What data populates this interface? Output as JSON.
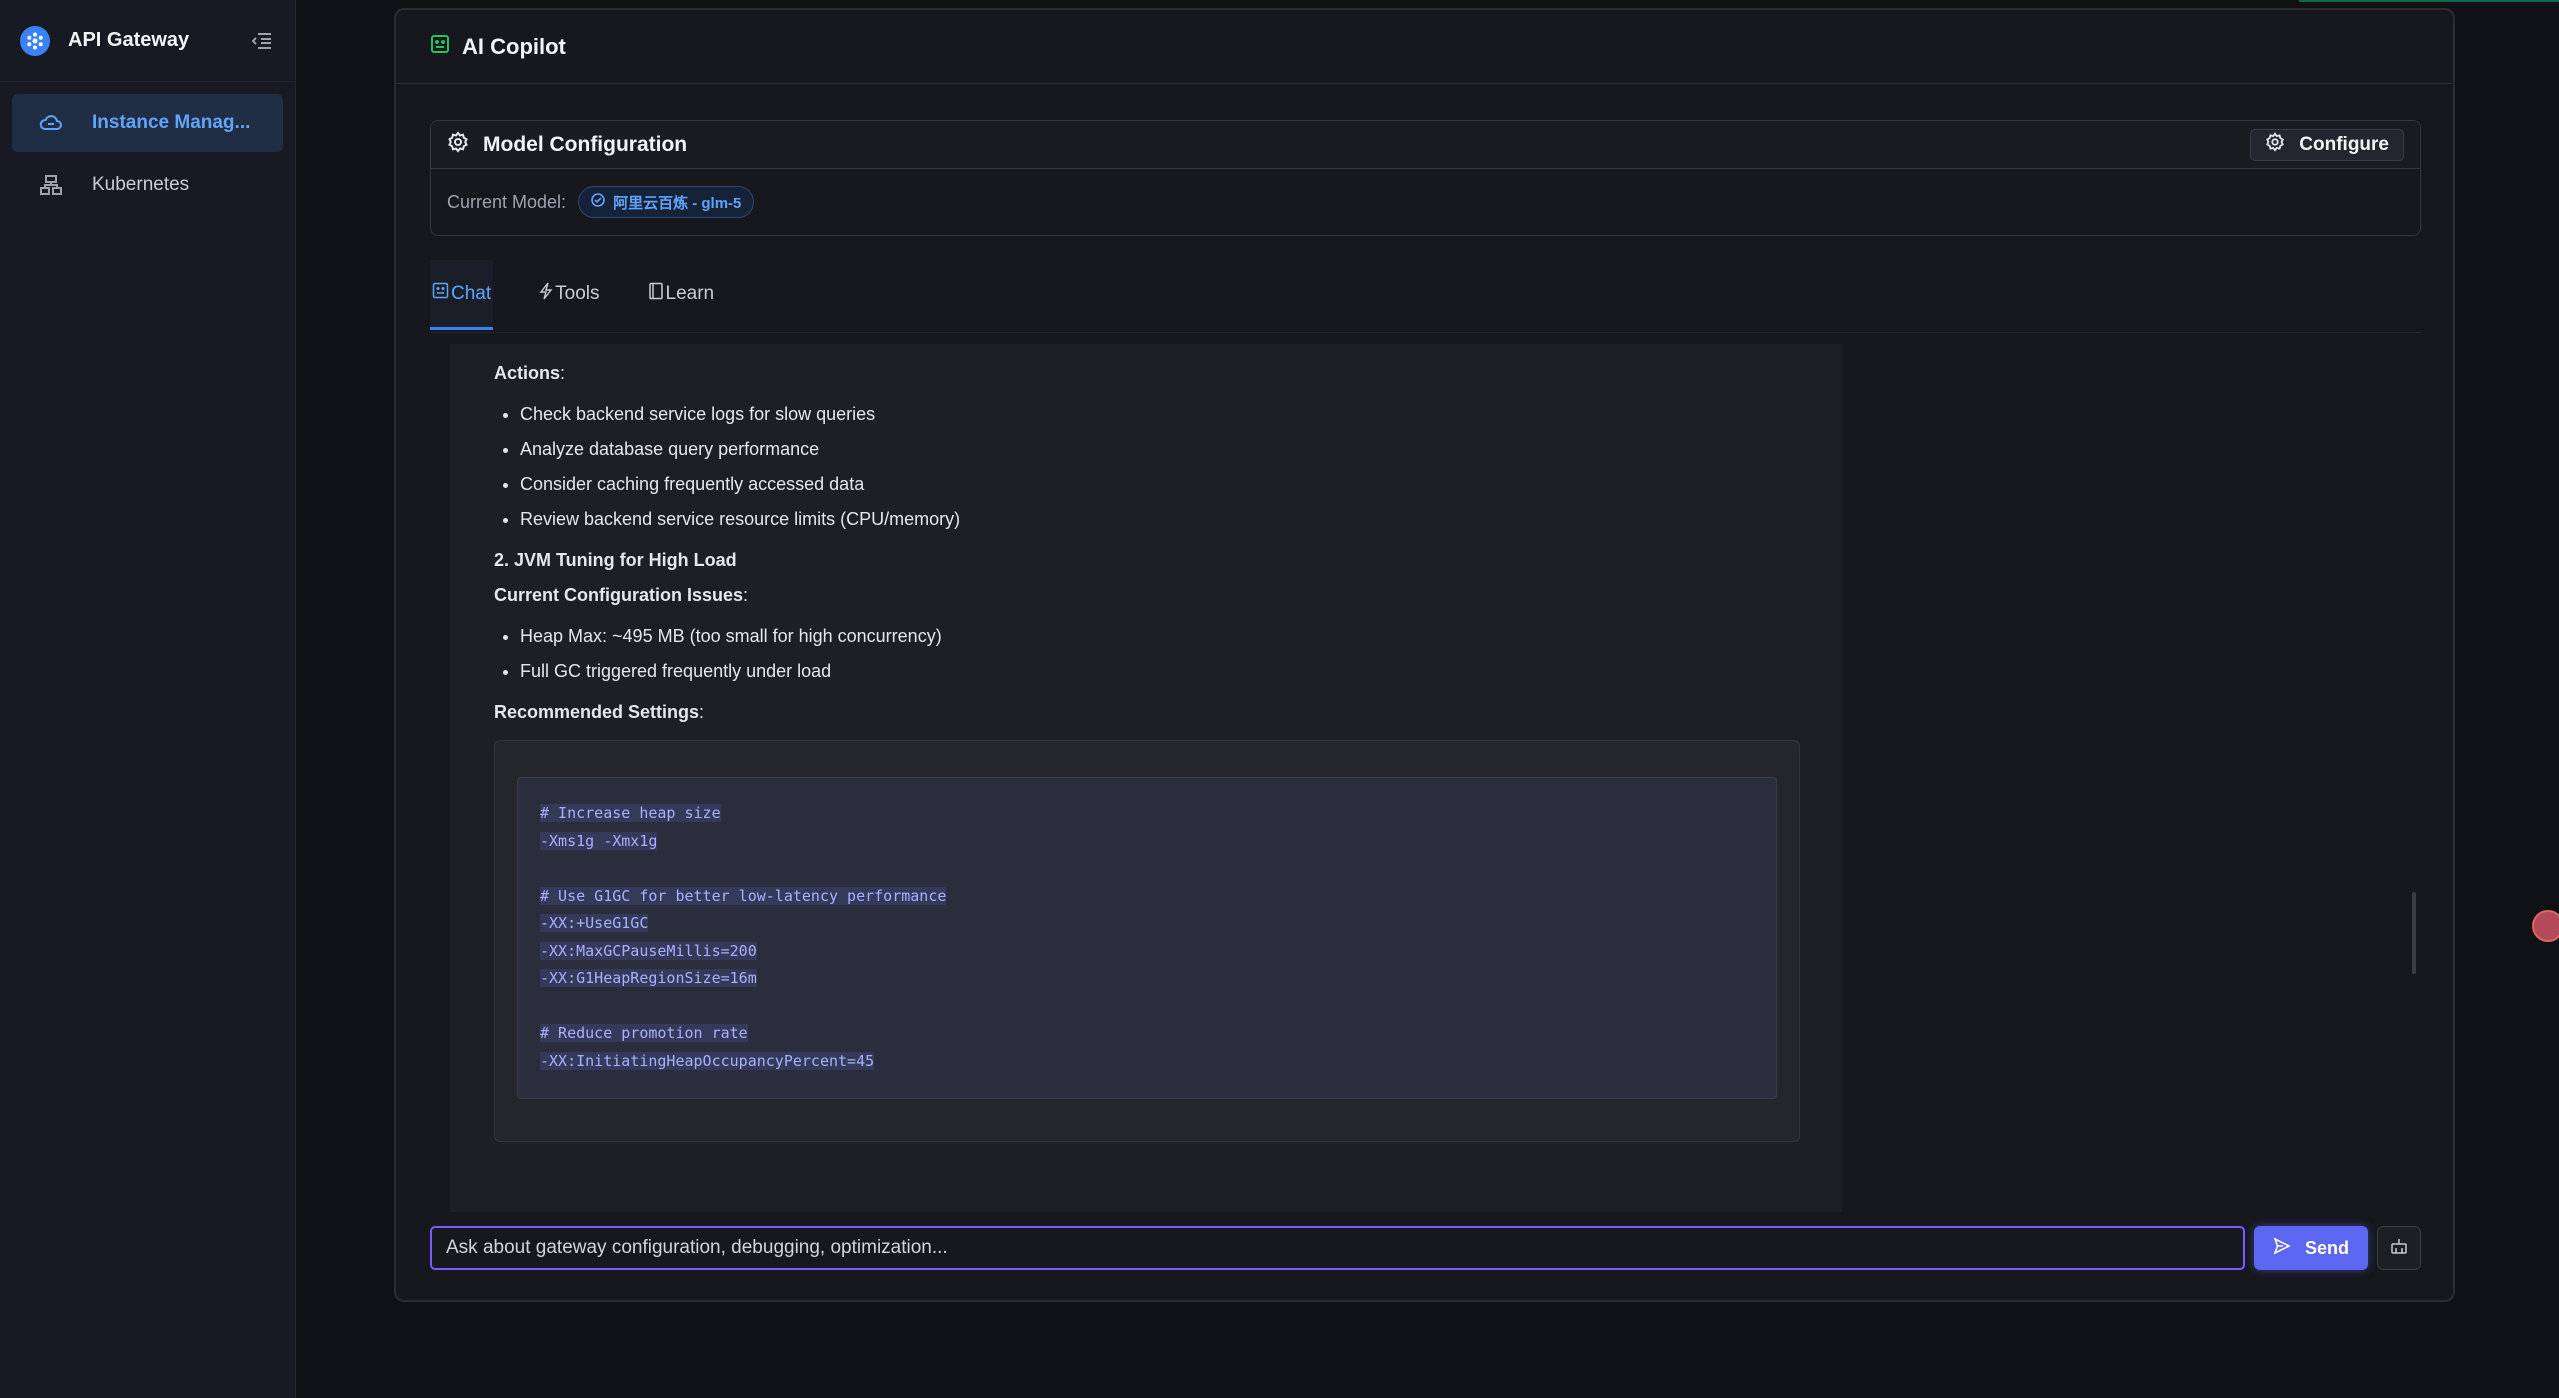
{
  "app": {
    "title": "API Gateway"
  },
  "sidebar": {
    "items": [
      {
        "label": "Instance Manag...",
        "icon": "cloud-icon",
        "active": true
      },
      {
        "label": "Kubernetes",
        "icon": "cluster-icon",
        "active": false
      }
    ]
  },
  "panel": {
    "title": "AI Copilot",
    "model": {
      "title": "Model Configuration",
      "configure_label": "Configure",
      "current_label": "Current Model:",
      "current_value": "阿里云百炼 - glm-5"
    },
    "tabs": [
      {
        "label": "Chat",
        "active": true
      },
      {
        "label": "Tools",
        "active": false
      },
      {
        "label": "Learn",
        "active": false
      }
    ]
  },
  "message": {
    "actions_heading": "Actions",
    "actions": [
      "Check backend service logs for slow queries",
      "Analyze database query performance",
      "Consider caching frequently accessed data",
      "Review backend service resource limits (CPU/memory)"
    ],
    "section2_title": "2. JVM Tuning for High Load",
    "issues_heading": "Current Configuration Issues",
    "issues": [
      "Heap Max: ~495 MB (too small for high concurrency)",
      "Full GC triggered frequently under load"
    ],
    "recommended_heading": "Recommended Settings",
    "code_lines": [
      "# Increase heap size",
      "-Xms1g -Xmx1g",
      "",
      "# Use G1GC for better low-latency performance",
      "-XX:+UseG1GC",
      "-XX:MaxGCPauseMillis=200",
      "-XX:G1HeapRegionSize=16m",
      "",
      "# Reduce promotion rate",
      "-XX:InitiatingHeapOccupancyPercent=45"
    ]
  },
  "input": {
    "placeholder": "Ask about gateway configuration, debugging, optimization...",
    "send_label": "Send"
  },
  "colors": {
    "accent": "#3b82f6",
    "send": "#5b67f0",
    "focus": "#7c5cff"
  }
}
